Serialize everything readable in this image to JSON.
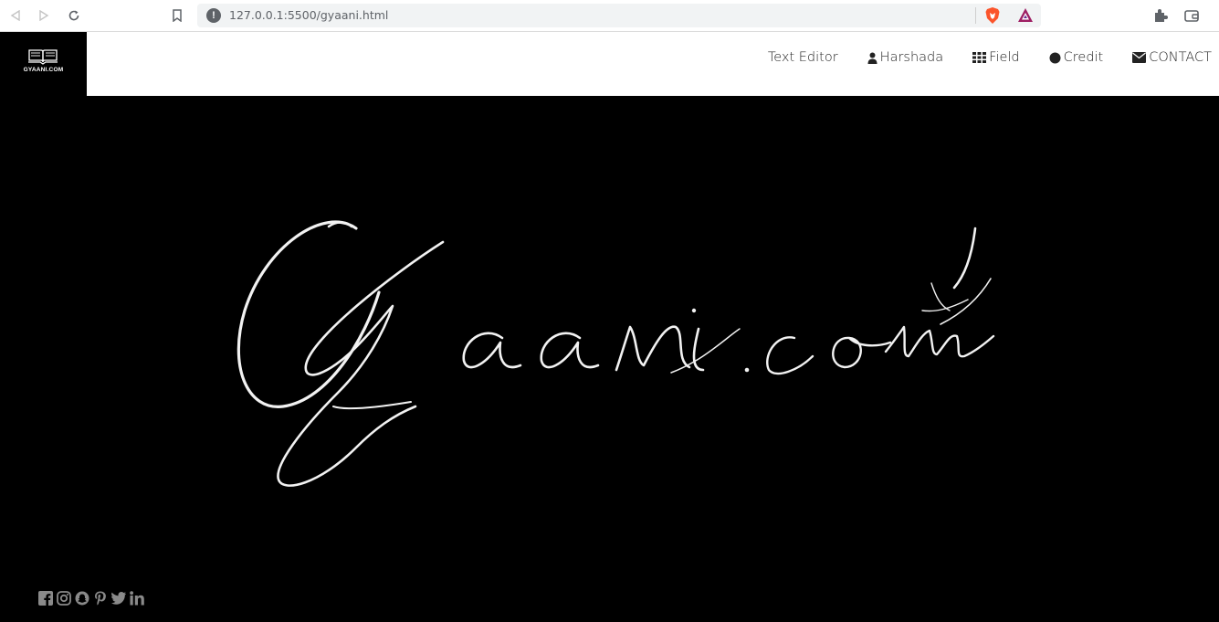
{
  "browser": {
    "url": "127.0.0.1:5500/gyaani.html"
  },
  "site": {
    "logo_text": "GYAANI.COM",
    "brand_script": "Gyaani.com"
  },
  "nav": {
    "items": [
      {
        "label": "Text Editor",
        "icon": "none"
      },
      {
        "label": "Harshada",
        "icon": "user-icon"
      },
      {
        "label": "Field",
        "icon": "grid-icon"
      },
      {
        "label": "Credit",
        "icon": "circle-icon"
      },
      {
        "label": "CONTACT",
        "icon": "envelope-icon"
      }
    ]
  },
  "social": [
    "facebook-icon",
    "instagram-icon",
    "snapchat-icon",
    "pinterest-icon",
    "twitter-icon",
    "linkedin-icon"
  ],
  "colors": {
    "hero_bg": "#000000",
    "header_bg": "#ffffff",
    "social_icon": "#8a8a8a"
  }
}
